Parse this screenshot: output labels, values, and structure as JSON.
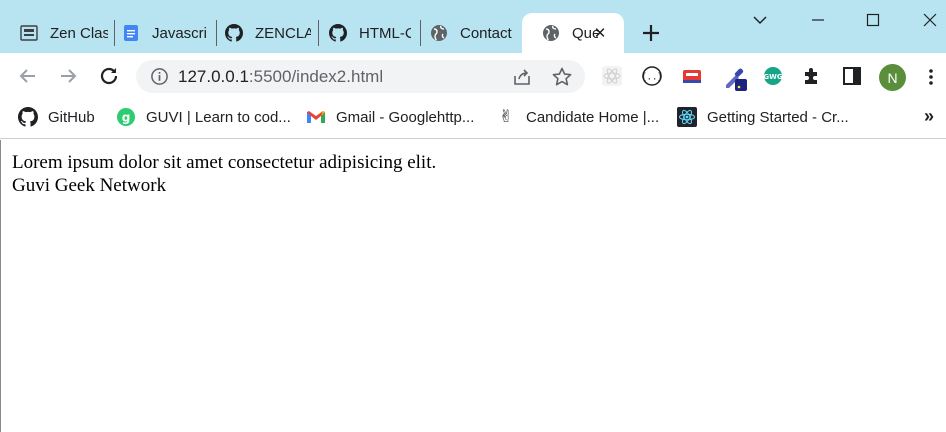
{
  "tabs": [
    {
      "title": "Zen Clas",
      "icon": "zen-class-icon"
    },
    {
      "title": "Javascrip",
      "icon": "docs-icon"
    },
    {
      "title": "ZENCLA",
      "icon": "github-icon"
    },
    {
      "title": "HTML-C",
      "icon": "github-icon"
    },
    {
      "title": "Contact",
      "icon": "globe-icon"
    },
    {
      "title": "Que",
      "icon": "globe-icon",
      "active": true
    }
  ],
  "tab_close_glyph": "✕",
  "address_bar": {
    "host": "127.0.0.1",
    "path": ":5500/index2.html"
  },
  "profile_initial": "N",
  "bookmarks": [
    {
      "label": "GitHub",
      "icon": "github-icon"
    },
    {
      "label": "GUVI | Learn to cod...",
      "icon": "guvi-icon"
    },
    {
      "label": "Gmail - Googlehttp...",
      "icon": "gmail-icon"
    },
    {
      "label": "Candidate Home |...",
      "icon": "victory-hand-icon"
    },
    {
      "label": "Getting Started - Cr...",
      "icon": "react-icon"
    }
  ],
  "bookmarks_more": "»",
  "page": {
    "line1": "Lorem ipsum dolor sit amet consectetur adipisicing elit.",
    "line2": "Guvi Geek Network"
  },
  "colors": {
    "tabstrip": "#b7e4f0",
    "omnibox": "#f1f3f4",
    "profile": "#5b8e3a"
  }
}
